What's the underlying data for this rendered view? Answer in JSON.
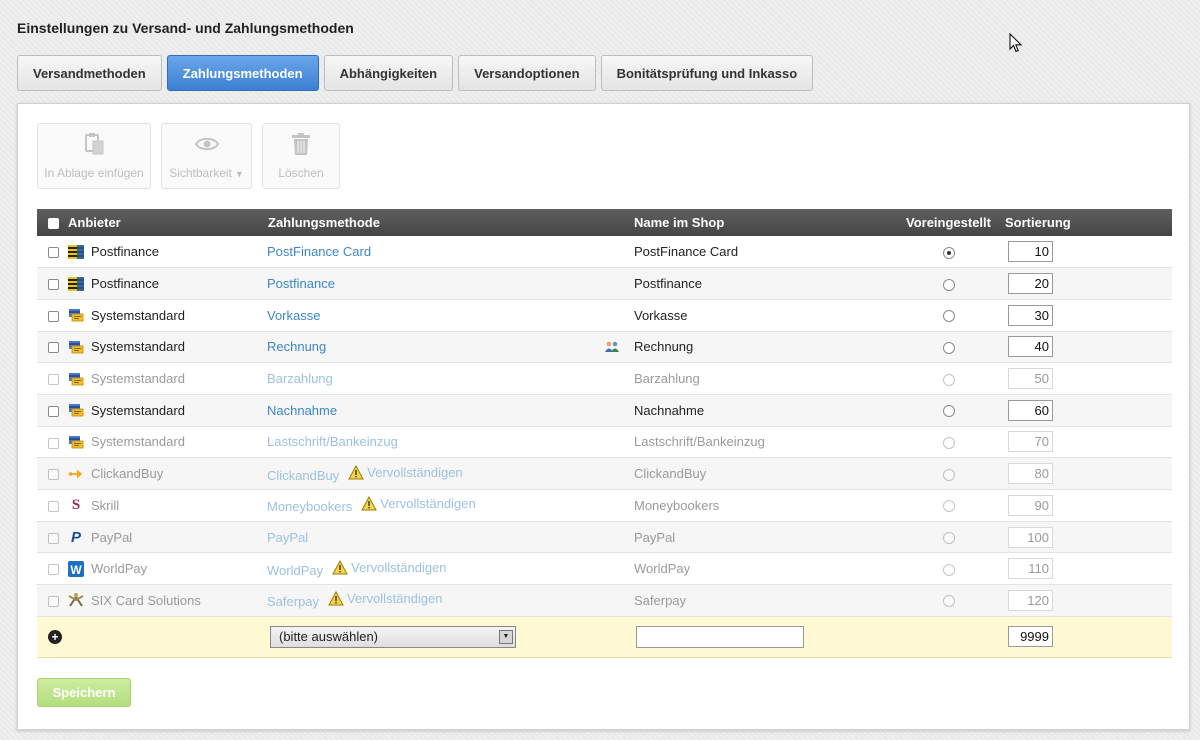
{
  "page": {
    "title": "Einstellungen zu Versand- und Zahlungsmethoden"
  },
  "tabs": [
    {
      "label": "Versandmethoden",
      "active": false
    },
    {
      "label": "Zahlungsmethoden",
      "active": true
    },
    {
      "label": "Abhängigkeiten",
      "active": false
    },
    {
      "label": "Versandoptionen",
      "active": false
    },
    {
      "label": "Bonitätsprüfung und Inkasso",
      "active": false
    }
  ],
  "toolbar": {
    "paste_label": "In Ablage einfügen",
    "visibility_label": "Sichtbarkeit",
    "delete_label": "Löschen"
  },
  "table": {
    "columns": {
      "provider": "Anbieter",
      "method": "Zahlungsmethode",
      "shop_name": "Name im Shop",
      "default": "Voreingestellt",
      "sort": "Sortierung"
    },
    "complete_label": "Vervollständigen",
    "rows": [
      {
        "provider": "Postfinance",
        "icon": "postfinance-icon",
        "method": "PostFinance Card",
        "shop_name": "PostFinance Card",
        "default": true,
        "sort": "10",
        "active": true,
        "warn": false,
        "group": false
      },
      {
        "provider": "Postfinance",
        "icon": "postfinance-icon",
        "method": "Postfinance",
        "shop_name": "Postfinance",
        "default": false,
        "sort": "20",
        "active": true,
        "warn": false,
        "group": false
      },
      {
        "provider": "Systemstandard",
        "icon": "system-payment-icon",
        "method": "Vorkasse",
        "shop_name": "Vorkasse",
        "default": false,
        "sort": "30",
        "active": true,
        "warn": false,
        "group": false
      },
      {
        "provider": "Systemstandard",
        "icon": "system-payment-icon",
        "method": "Rechnung",
        "shop_name": "Rechnung",
        "default": false,
        "sort": "40",
        "active": true,
        "warn": false,
        "group": true
      },
      {
        "provider": "Systemstandard",
        "icon": "system-payment-icon",
        "method": "Barzahlung",
        "shop_name": "Barzahlung",
        "default": false,
        "sort": "50",
        "active": false,
        "warn": false,
        "group": false
      },
      {
        "provider": "Systemstandard",
        "icon": "system-payment-icon",
        "method": "Nachnahme",
        "shop_name": "Nachnahme",
        "default": false,
        "sort": "60",
        "active": true,
        "warn": false,
        "group": false
      },
      {
        "provider": "Systemstandard",
        "icon": "system-payment-icon",
        "method": "Lastschrift/Bankeinzug",
        "shop_name": "Lastschrift/Bankeinzug",
        "default": false,
        "sort": "70",
        "active": false,
        "warn": false,
        "group": false
      },
      {
        "provider": "ClickandBuy",
        "icon": "clickandbuy-icon",
        "method": "ClickandBuy",
        "shop_name": "ClickandBuy",
        "default": false,
        "sort": "80",
        "active": false,
        "warn": true,
        "group": false
      },
      {
        "provider": "Skrill",
        "icon": "skrill-icon",
        "method": "Moneybookers",
        "shop_name": "Moneybookers",
        "default": false,
        "sort": "90",
        "active": false,
        "warn": true,
        "group": false
      },
      {
        "provider": "PayPal",
        "icon": "paypal-icon",
        "method": "PayPal",
        "shop_name": "PayPal",
        "default": false,
        "sort": "100",
        "active": false,
        "warn": false,
        "group": false
      },
      {
        "provider": "WorldPay",
        "icon": "worldpay-icon",
        "method": "WorldPay",
        "shop_name": "WorldPay",
        "default": false,
        "sort": "110",
        "active": false,
        "warn": true,
        "group": false
      },
      {
        "provider": "SIX Card Solutions",
        "icon": "six-card-solutions-icon",
        "method": "Saferpay",
        "shop_name": "Saferpay",
        "default": false,
        "sort": "120",
        "active": false,
        "warn": true,
        "group": false
      }
    ]
  },
  "add_row": {
    "select_value": "(bitte auswählen)",
    "shop_name_value": "",
    "sort_value": "9999"
  },
  "save_label": "Speichern"
}
